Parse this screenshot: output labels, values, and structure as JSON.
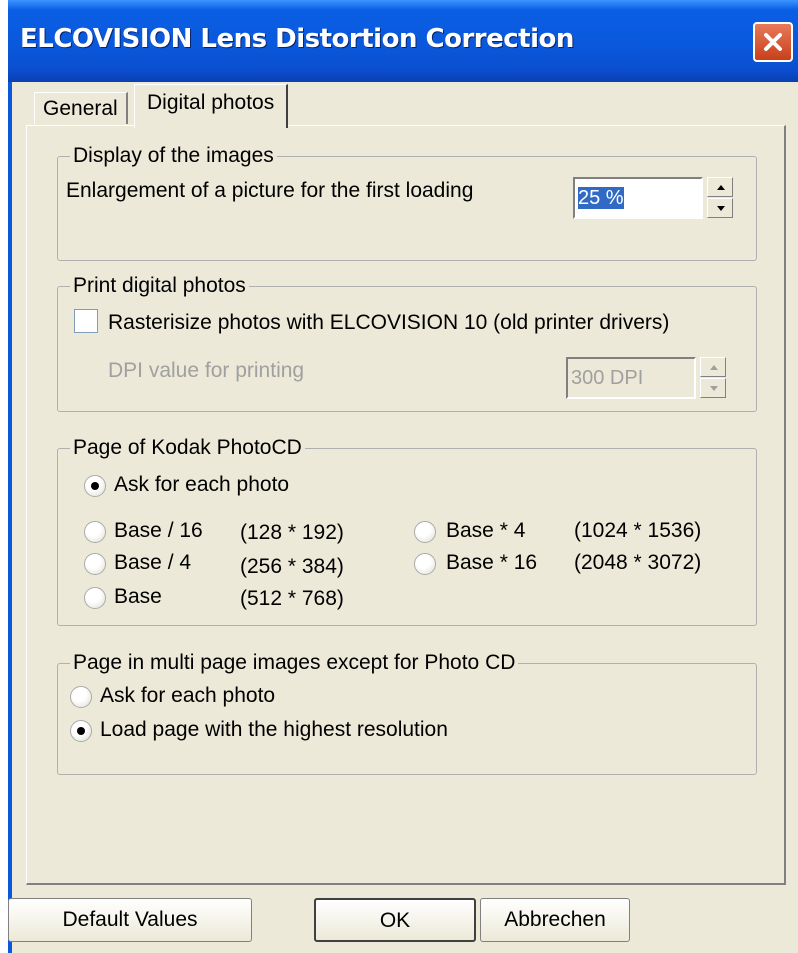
{
  "window": {
    "title": "ELCOVISION Lens Distortion Correction",
    "close_icon": "close-x"
  },
  "tabs": [
    {
      "label": "General",
      "active": false
    },
    {
      "label": "Digital photos",
      "active": true
    }
  ],
  "display_group": {
    "legend": "Display of the images",
    "enlargement_label": "Enlargement of a picture for the first loading",
    "enlargement_value": "25 %"
  },
  "print_group": {
    "legend": "Print digital photos",
    "rasterize_label": "Rasterisize photos with ELCOVISION 10 (old printer drivers)",
    "rasterize_checked": false,
    "dpi_label": "DPI value for printing",
    "dpi_value": "300 DPI"
  },
  "photocd_group": {
    "legend": "Page of Kodak PhotoCD",
    "ask_label": "Ask for each photo",
    "options": [
      {
        "label": "Base / 16",
        "size": "(128 * 192)"
      },
      {
        "label": "Base / 4",
        "size": "(256 * 384)"
      },
      {
        "label": "Base",
        "size": "(512 * 768)"
      },
      {
        "label": "Base * 4",
        "size": "(1024 * 1536)"
      },
      {
        "label": "Base * 16",
        "size": "(2048 * 3072)"
      }
    ],
    "selected": "Ask for each photo"
  },
  "multipage_group": {
    "legend": "Page in multi page images except for Photo CD",
    "ask_label": "Ask for each photo",
    "highest_label": "Load page with the highest resolution",
    "selected": "Load page with the highest resolution"
  },
  "buttons": {
    "default_values": "Default Values",
    "ok": "OK",
    "cancel": "Abbrechen"
  },
  "colors": {
    "titlebar": "#0a58dc",
    "dialog_bg": "#ece9d8",
    "close_button": "#d4502e",
    "selection": "#316ac5"
  }
}
